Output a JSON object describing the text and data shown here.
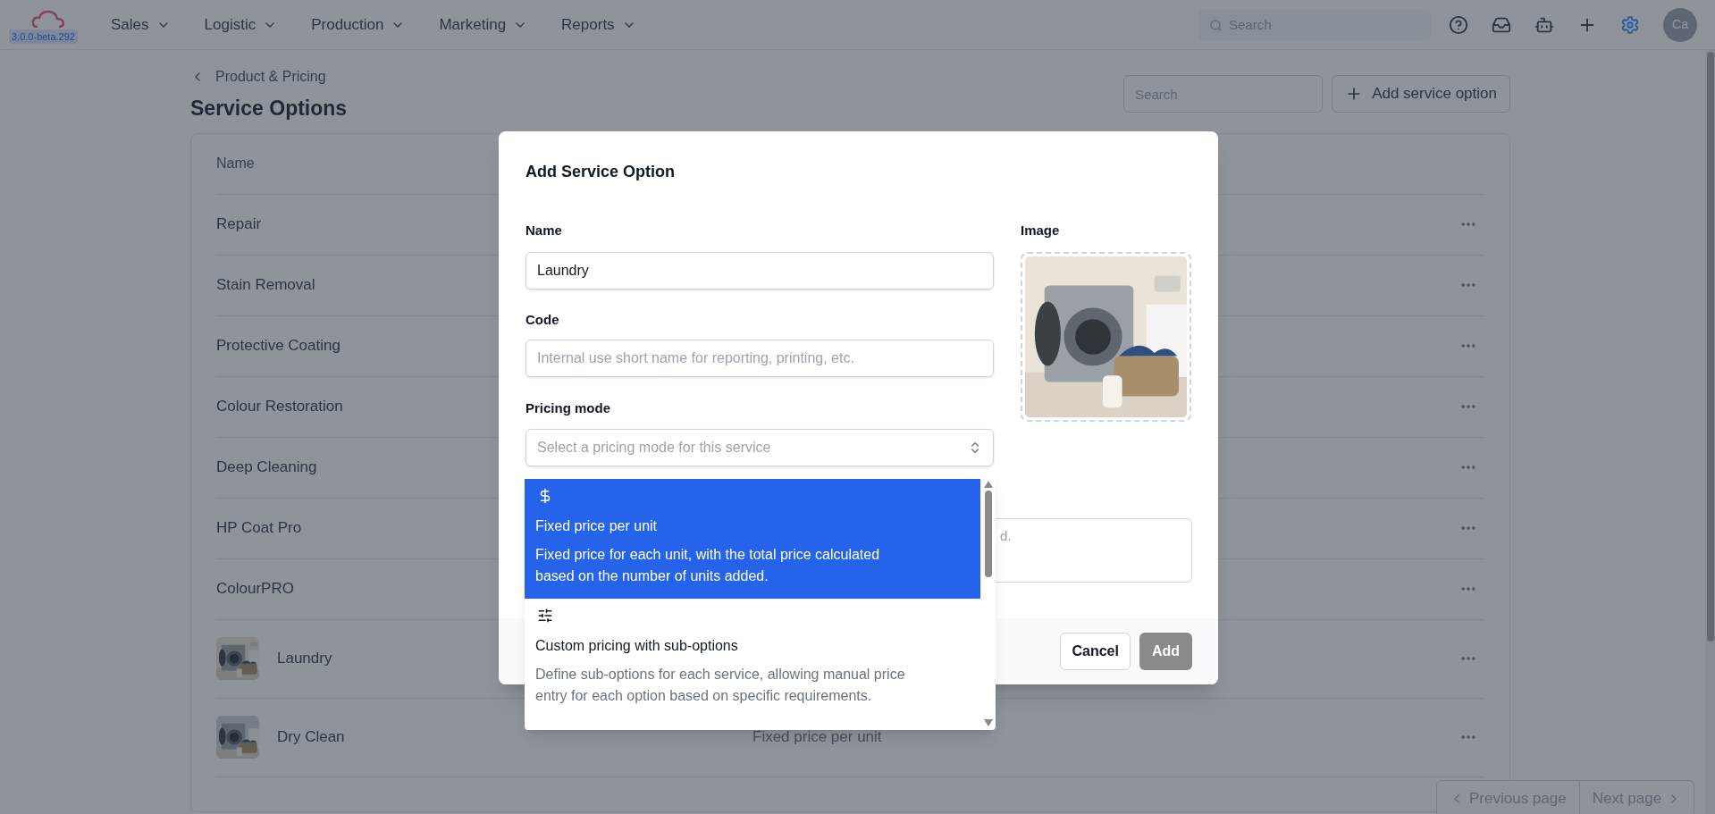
{
  "topbar": {
    "version": "3.0.0-beta.292",
    "nav": [
      {
        "label": "Sales"
      },
      {
        "label": "Logistic"
      },
      {
        "label": "Production"
      },
      {
        "label": "Marketing"
      },
      {
        "label": "Reports"
      }
    ],
    "search": {
      "placeholder": "Search"
    },
    "avatar": "Ca"
  },
  "page": {
    "breadcrumb": "Product & Pricing",
    "title": "Service Options",
    "search": {
      "placeholder": "Search"
    },
    "add_button": "Add service option"
  },
  "table": {
    "columns": [
      "Name"
    ],
    "rows": [
      {
        "name": "Repair",
        "kind": "plain"
      },
      {
        "name": "Stain Removal",
        "kind": "plain"
      },
      {
        "name": "Protective Coating",
        "kind": "plain"
      },
      {
        "name": "Colour Restoration",
        "kind": "plain"
      },
      {
        "name": "Deep Cleaning",
        "kind": "plain"
      },
      {
        "name": "HP Coat Pro",
        "kind": "plain"
      },
      {
        "name": "ColourPRO",
        "kind": "plain"
      },
      {
        "name": "Laundry"
      },
      {
        "name": "Dry Clean",
        "pricing": "Fixed price per unit"
      }
    ]
  },
  "pagination": {
    "previous": "Previous page",
    "next": "Next page"
  },
  "dialog": {
    "title": "Add Service Option",
    "name": {
      "label": "Name",
      "value": "Laundry"
    },
    "code": {
      "label": "Code",
      "placeholder": "Internal use short name for reporting, printing, etc."
    },
    "pricing_mode": {
      "label": "Pricing mode",
      "placeholder": "Select a pricing mode for this service"
    },
    "image": {
      "label": "Image"
    },
    "description": {
      "placeholder": "d."
    },
    "options": [
      {
        "kind": "fixed",
        "title": "Fixed price per unit",
        "description": "Fixed price for each unit, with the total price calculated based on the number of units added.",
        "selected": true
      },
      {
        "kind": "custom",
        "title": "Custom pricing with sub-options",
        "description": "Define sub-options for each service, allowing manual price entry for each option based on specific requirements.",
        "selected": false
      }
    ],
    "cancel": "Cancel",
    "add": {
      "label": "Add",
      "disabled": true
    }
  }
}
